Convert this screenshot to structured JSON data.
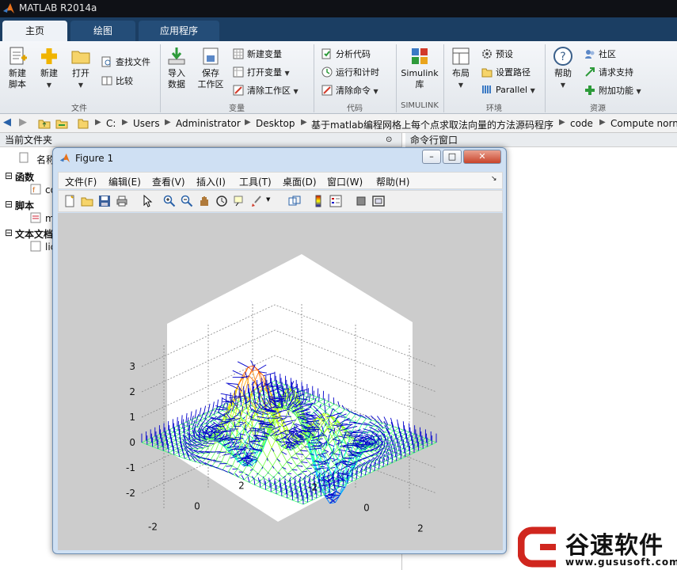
{
  "app": {
    "title": "MATLAB R2014a"
  },
  "tabs": [
    "主页",
    "绘图",
    "应用程序"
  ],
  "ribbon": {
    "file": {
      "new_script": "新建\n脚本",
      "new": "新建",
      "open": "打开",
      "find_files": "查找文件",
      "compare": "比较",
      "group": "文件"
    },
    "variable": {
      "import": "导入\n数据",
      "save_ws": "保存\n工作区",
      "new_var": "新建变量",
      "open_var": "打开变量",
      "clear_ws": "清除工作区",
      "group": "变量"
    },
    "code": {
      "analyze": "分析代码",
      "run_time": "运行和计时",
      "clear_cmd": "清除命令",
      "group": "代码"
    },
    "simulink": {
      "label": "Simulink\n库",
      "group": "SIMULINK"
    },
    "env": {
      "layout": "布局",
      "prefs": "预设",
      "set_path": "设置路径",
      "parallel": "Parallel",
      "group": "环境"
    },
    "resources": {
      "help": "帮助",
      "community": "社区",
      "support": "请求支持",
      "addons": "附加功能",
      "group": "资源"
    }
  },
  "address": {
    "crumbs": [
      "C:",
      "Users",
      "Administrator",
      "Desktop",
      "基于matlab编程网格上每个点求取法向量的方法源码程序",
      "code",
      "Compute norn"
    ]
  },
  "left_panel": {
    "title": "当前文件夹",
    "col_name": "名称",
    "groups": [
      {
        "label": "函数",
        "items": [
          "co"
        ]
      },
      {
        "label": "脚本",
        "items": [
          "m"
        ]
      },
      {
        "label": "文本文档",
        "items": [
          "lic"
        ]
      }
    ]
  },
  "right_panel": {
    "title": "命令行窗口"
  },
  "figure": {
    "title": "Figure 1",
    "menus": [
      "文件(F)",
      "编辑(E)",
      "查看(V)",
      "插入(I)",
      "工具(T)",
      "桌面(D)",
      "窗口(W)",
      "帮助(H)"
    ],
    "ztick_labels": [
      "3",
      "2",
      "1",
      "0",
      "-1",
      "-2"
    ],
    "left_axis_ticks": [
      "2",
      "0",
      "-2"
    ],
    "right_axis_ticks": [
      "-2",
      "0",
      "2"
    ]
  },
  "watermark": {
    "brand": "谷速软件",
    "url": "www.gususoft.com"
  },
  "colors": {
    "accent_blue": "#1b3e63",
    "surface_red": "#d62020",
    "arrow_blue": "#0000cc"
  }
}
